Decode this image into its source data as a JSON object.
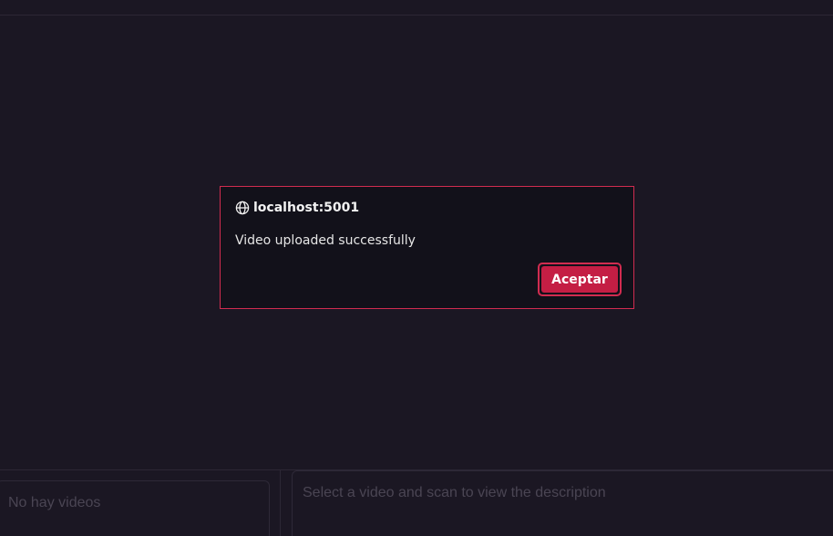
{
  "dialog": {
    "origin": "localhost:5001",
    "message": "Video uploaded successfully",
    "accept_label": "Aceptar",
    "icon": "globe-icon"
  },
  "video_list": {
    "empty_text": "No hay videos"
  },
  "description": {
    "placeholder": "Select a video and scan to view the description"
  },
  "colors": {
    "background": "#1b1723",
    "dialog_background": "#12111a",
    "accent": "#c41e44",
    "accent_border": "#d12c50"
  }
}
